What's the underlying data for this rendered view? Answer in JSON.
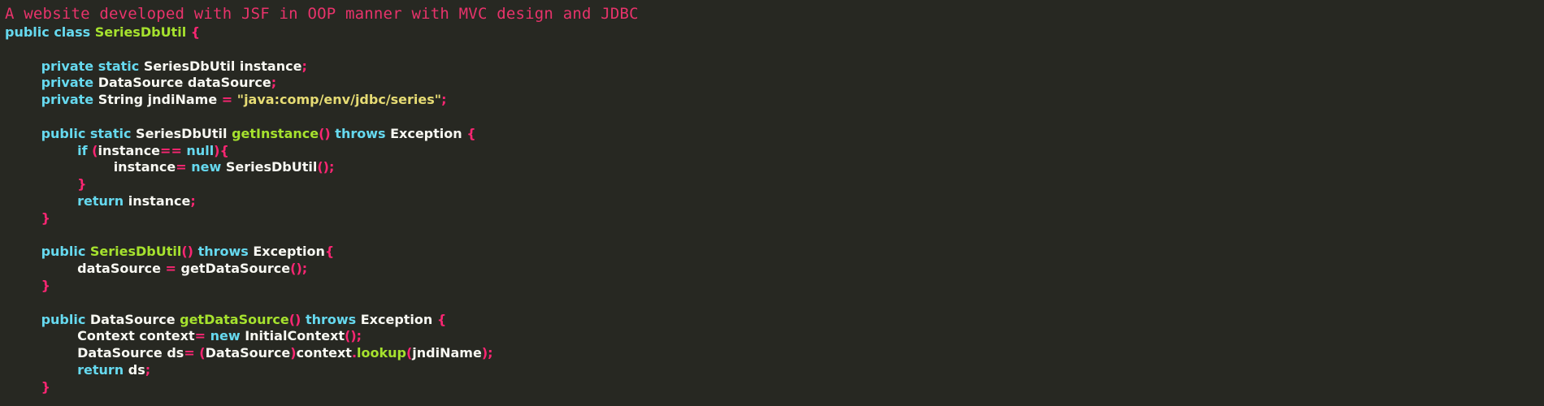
{
  "title": "A website developed with JSF in OOP manner with MVC design and JDBC",
  "colors": {
    "background": "#272822",
    "title": "#e8336b",
    "keyword": "#66d9ef",
    "function": "#a6e22e",
    "string": "#e6db74",
    "punctuation": "#f92672",
    "text": "#f8f8f2"
  },
  "code": {
    "language": "Java",
    "lines": [
      [
        [
          "kw",
          "public class "
        ],
        [
          "fn",
          "SeriesDbUtil"
        ],
        [
          "pun",
          " {"
        ]
      ],
      [],
      [
        [
          "txt",
          "        "
        ],
        [
          "kw",
          "private static "
        ],
        [
          "txt",
          "SeriesDbUtil instance"
        ],
        [
          "pun",
          ";"
        ]
      ],
      [
        [
          "txt",
          "        "
        ],
        [
          "kw",
          "private "
        ],
        [
          "txt",
          "DataSource dataSource"
        ],
        [
          "pun",
          ";"
        ]
      ],
      [
        [
          "txt",
          "        "
        ],
        [
          "kw",
          "private "
        ],
        [
          "txt",
          "String jndiName "
        ],
        [
          "pun",
          "= "
        ],
        [
          "str",
          "\"java:comp/env/jdbc/series\""
        ],
        [
          "pun",
          ";"
        ]
      ],
      [],
      [
        [
          "txt",
          "        "
        ],
        [
          "kw",
          "public static "
        ],
        [
          "txt",
          "SeriesDbUtil "
        ],
        [
          "fn",
          "getInstance"
        ],
        [
          "pun",
          "() "
        ],
        [
          "kw",
          "throws "
        ],
        [
          "txt",
          "Exception "
        ],
        [
          "pun",
          "{"
        ]
      ],
      [
        [
          "txt",
          "                "
        ],
        [
          "kw",
          "if "
        ],
        [
          "pun",
          "("
        ],
        [
          "txt",
          "instance"
        ],
        [
          "pun",
          "== "
        ],
        [
          "kw",
          "null"
        ],
        [
          "pun",
          "){"
        ]
      ],
      [
        [
          "txt",
          "                        instance"
        ],
        [
          "pun",
          "= "
        ],
        [
          "kw",
          "new "
        ],
        [
          "txt",
          "SeriesDbUtil"
        ],
        [
          "pun",
          "();"
        ]
      ],
      [
        [
          "txt",
          "                "
        ],
        [
          "pun",
          "}"
        ]
      ],
      [
        [
          "txt",
          "                "
        ],
        [
          "kw",
          "return "
        ],
        [
          "txt",
          "instance"
        ],
        [
          "pun",
          ";"
        ]
      ],
      [
        [
          "txt",
          "        "
        ],
        [
          "pun",
          "}"
        ]
      ],
      [],
      [
        [
          "txt",
          "        "
        ],
        [
          "kw",
          "public "
        ],
        [
          "fn",
          "SeriesDbUtil"
        ],
        [
          "pun",
          "() "
        ],
        [
          "kw",
          "throws "
        ],
        [
          "txt",
          "Exception"
        ],
        [
          "pun",
          "{"
        ]
      ],
      [
        [
          "txt",
          "                dataSource "
        ],
        [
          "pun",
          "= "
        ],
        [
          "txt",
          "getDataSource"
        ],
        [
          "pun",
          "();"
        ]
      ],
      [
        [
          "txt",
          "        "
        ],
        [
          "pun",
          "}"
        ]
      ],
      [],
      [
        [
          "txt",
          "        "
        ],
        [
          "kw",
          "public "
        ],
        [
          "txt",
          "DataSource "
        ],
        [
          "fn",
          "getDataSource"
        ],
        [
          "pun",
          "() "
        ],
        [
          "kw",
          "throws "
        ],
        [
          "txt",
          "Exception "
        ],
        [
          "pun",
          "{"
        ]
      ],
      [
        [
          "txt",
          "                Context context"
        ],
        [
          "pun",
          "= "
        ],
        [
          "kw",
          "new "
        ],
        [
          "txt",
          "InitialContext"
        ],
        [
          "pun",
          "();"
        ]
      ],
      [
        [
          "txt",
          "                DataSource ds"
        ],
        [
          "pun",
          "= ("
        ],
        [
          "txt",
          "DataSource"
        ],
        [
          "pun",
          ")"
        ],
        [
          "txt",
          "context"
        ],
        [
          "pun",
          "."
        ],
        [
          "fn",
          "lookup"
        ],
        [
          "pun",
          "("
        ],
        [
          "txt",
          "jndiName"
        ],
        [
          "pun",
          ");"
        ]
      ],
      [
        [
          "txt",
          "                "
        ],
        [
          "kw",
          "return "
        ],
        [
          "txt",
          "ds"
        ],
        [
          "pun",
          ";"
        ]
      ],
      [
        [
          "txt",
          "        "
        ],
        [
          "pun",
          "}"
        ]
      ]
    ]
  }
}
